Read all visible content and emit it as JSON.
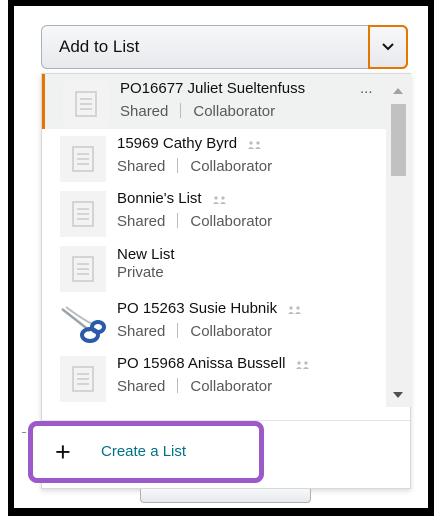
{
  "select": {
    "label": "Add to List"
  },
  "lists": [
    {
      "name": "PO16677 Juliet Sueltenfuss",
      "privacy": "Shared",
      "role": "Collaborator",
      "selected": true,
      "icon": "list-icon",
      "more": "..."
    },
    {
      "name": "15969 Cathy Byrd",
      "privacy": "Shared",
      "role": "Collaborator",
      "icon": "list-icon"
    },
    {
      "name": "Bonnie's List",
      "privacy": "Shared",
      "role": "Collaborator",
      "icon": "list-icon"
    },
    {
      "name": "New List",
      "privacy": "Private",
      "role": "",
      "icon": "list-icon"
    },
    {
      "name": "PO 15263 Susie Hubnik",
      "privacy": "Shared",
      "role": "Collaborator",
      "icon": "scissors-photo"
    },
    {
      "name": "PO 15968 Anissa Bussell",
      "privacy": "Shared",
      "role": "Collaborator",
      "icon": "list-icon"
    }
  ],
  "create": {
    "label": "Create a List"
  },
  "colors": {
    "accent": "#e77600",
    "link": "#007185",
    "highlight": "#9b59c9"
  }
}
